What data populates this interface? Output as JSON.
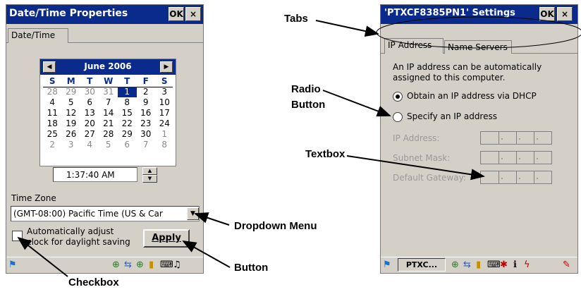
{
  "left_window": {
    "title": "Date/Time Properties",
    "ok_label": "OK",
    "close_label": "×",
    "tab_label": "Date/Time",
    "calendar": {
      "month_year": "June 2006",
      "days_of_week": [
        "S",
        "M",
        "T",
        "W",
        "T",
        "F",
        "S"
      ],
      "weeks": [
        [
          "28",
          "29",
          "30",
          "31",
          "1",
          "2",
          "3"
        ],
        [
          "4",
          "5",
          "6",
          "7",
          "8",
          "9",
          "10"
        ],
        [
          "11",
          "12",
          "13",
          "14",
          "15",
          "16",
          "17"
        ],
        [
          "18",
          "19",
          "20",
          "21",
          "22",
          "23",
          "24"
        ],
        [
          "25",
          "26",
          "27",
          "28",
          "29",
          "30",
          "1"
        ],
        [
          "2",
          "3",
          "4",
          "5",
          "6",
          "7",
          "8"
        ]
      ],
      "selected_day": "1"
    },
    "time_value": "1:37:40 AM",
    "time_zone_label": "Time Zone",
    "time_zone_value": "(GMT-08:00) Pacific Time (US & Car",
    "daylight_line1": "Automatically adjust",
    "daylight_line2": "clock for daylight saving",
    "daylight_checked": false,
    "apply_label": "Apply"
  },
  "right_window": {
    "title": "'PTXCF8385PN1' Settings",
    "ok_label": "OK",
    "close_label": "×",
    "tabs": [
      "IP Address",
      "Name Servers"
    ],
    "info_line1": "An IP address can be automatically",
    "info_line2": "assigned to this computer.",
    "radio_dhcp_label": "Obtain an IP address via DHCP",
    "radio_specify_label": "Specify an IP address",
    "selected_radio": "dhcp",
    "ip_address_label": "IP Address:",
    "subnet_mask_label": "Subnet Mask:",
    "default_gateway_label": "Default Gateway:",
    "taskbar_label": "PTXC..."
  },
  "callouts": {
    "tabs": "Tabs",
    "radio_line1": "Radio",
    "radio_line2": "Button",
    "textbox": "Textbox",
    "dropdown": "Dropdown Menu",
    "button": "Button",
    "checkbox": "Checkbox"
  },
  "colors": {
    "titlebar": "#0a2a8c",
    "dialog_bg": "#d4d0c8"
  }
}
